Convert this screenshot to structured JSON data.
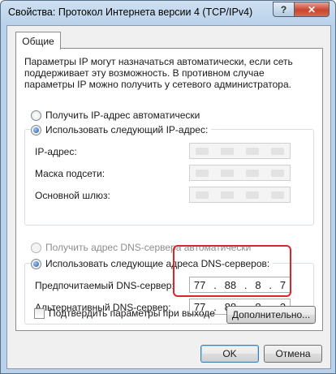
{
  "window": {
    "title": "Свойства: Протокол Интернета версии 4 (TCP/IPv4)",
    "help_glyph": "?",
    "close_glyph": "✕"
  },
  "tabs": [
    {
      "label": "Общие"
    }
  ],
  "general": {
    "description": "Параметры IP могут назначаться автоматически, если сеть поддерживает эту возможность. В противном случае параметры IP можно получить у сетевого администратора.",
    "ip_auto_label": "Получить IP-адрес автоматически",
    "ip_manual_label": "Использовать следующий IP-адрес:",
    "ip_manual_selected": true,
    "ip_fields": [
      {
        "label": "IP-адрес:"
      },
      {
        "label": "Маска подсети:"
      },
      {
        "label": "Основной шлюз:"
      }
    ],
    "dns_auto_label": "Получить адрес DNS-сервера автоматически",
    "dns_manual_label": "Использовать следующие адреса DNS-серверов:",
    "dns_manual_selected": true,
    "preferred_dns": {
      "label": "Предпочитаемый DNS-сервер:",
      "octets": [
        "77",
        "88",
        "8",
        "7"
      ]
    },
    "alternate_dns": {
      "label": "Альтернативный DNS-сервер:",
      "octets": [
        "77",
        "88",
        "8",
        "3"
      ]
    },
    "validate_label": "Подтвердить параметры при выходе",
    "validate_checked": false,
    "advanced_label": "Дополнительно..."
  },
  "footer": {
    "ok_label": "OK",
    "cancel_label": "Отмена"
  },
  "colors": {
    "highlight": "#d9262a",
    "title_bar": "#b9d1ea",
    "close_button": "#c9452c"
  }
}
